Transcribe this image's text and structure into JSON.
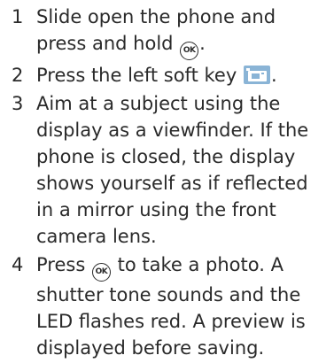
{
  "steps": [
    {
      "number": "1",
      "text_before": "Slide open the phone and press and hold ",
      "icon": "ok-key-icon",
      "icon_label": "OK",
      "text_after": "."
    },
    {
      "number": "2",
      "text_before": "Press the left soft key ",
      "icon": "camera-softkey-icon",
      "text_after": "."
    },
    {
      "number": "3",
      "text": "Aim at a subject using the display as a viewfinder. If the phone is closed, the display shows yourself as if reflected in a mirror using the front camera lens."
    },
    {
      "number": "4",
      "text_before": "Press ",
      "icon": "ok-key-icon",
      "icon_label": "OK",
      "text_after": " to take a photo. A shutter tone sounds and the LED flashes red. A preview is displayed before saving."
    }
  ],
  "colors": {
    "text": "#2a2a2a",
    "softkey_icon_bg": "#8ab4d6",
    "softkey_icon_fg": "#ffffff"
  }
}
